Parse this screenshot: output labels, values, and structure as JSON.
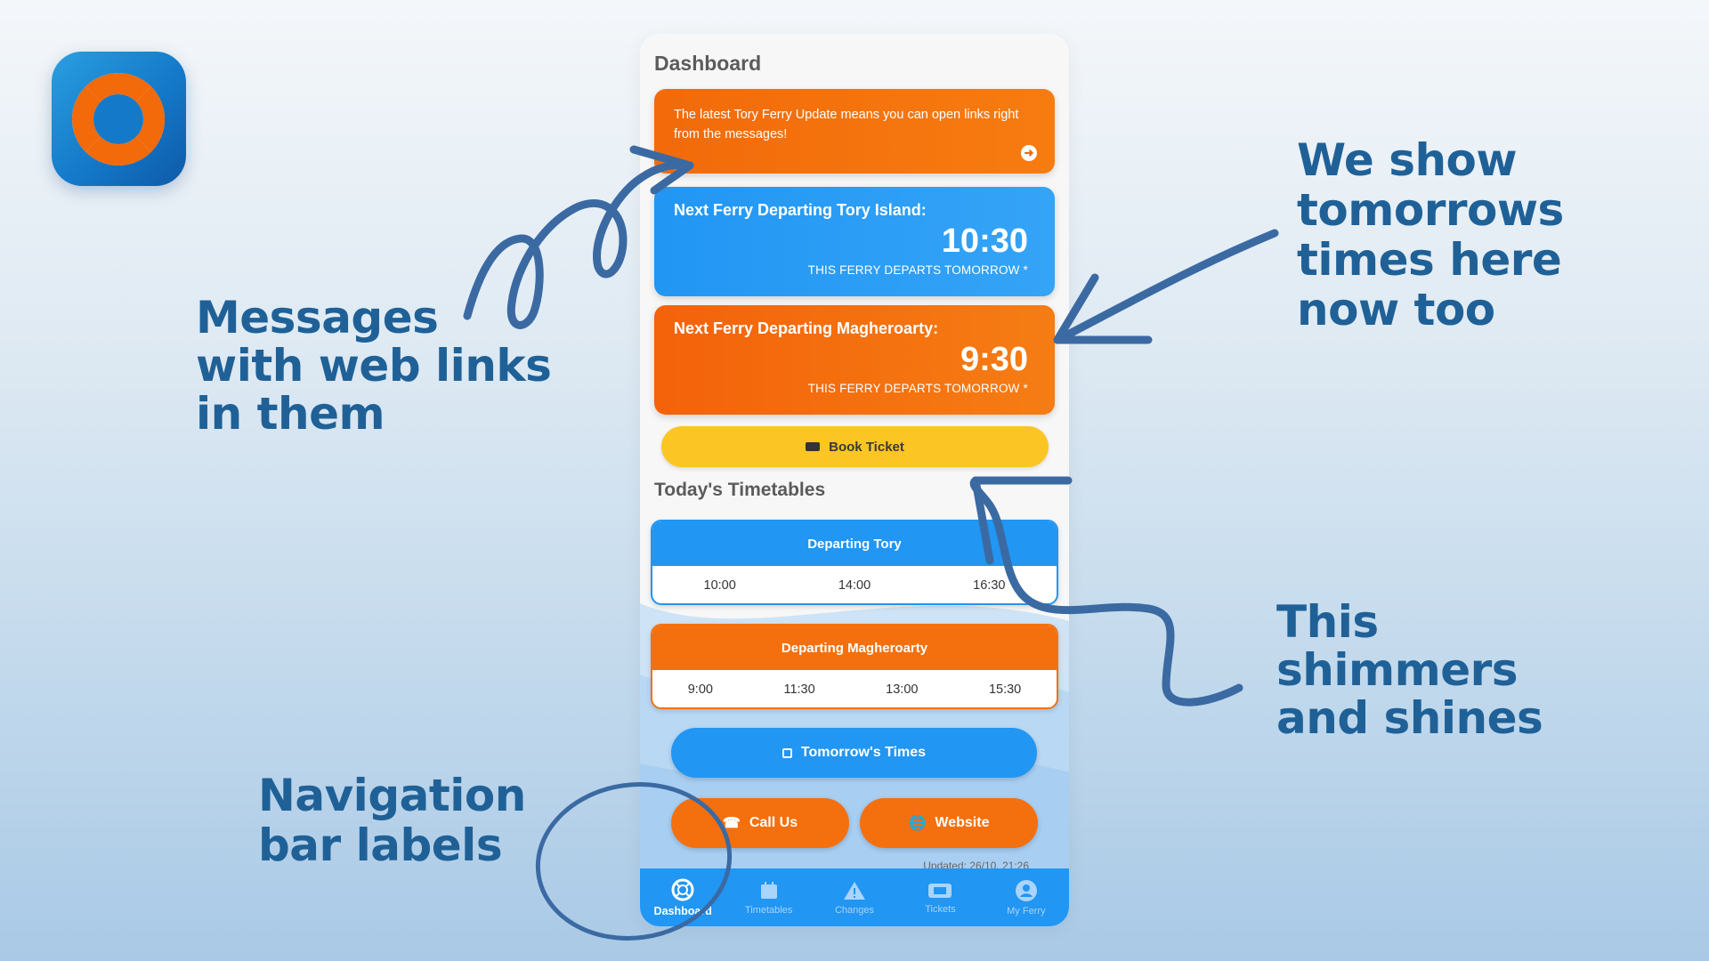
{
  "app": {
    "icon": "lifebuoy-icon",
    "dashboard_title": "Dashboard",
    "message": {
      "text": "The latest Tory Ferry Update means you can open links right from the messages!",
      "arrow_icon": "arrow-right-circle-icon"
    },
    "next_tory": {
      "label": "Next Ferry Departing Tory Island:",
      "time": "10:30",
      "note": "THIS FERRY DEPARTS TOMORROW *"
    },
    "next_magheroarty": {
      "label": "Next Ferry Departing Magheroarty:",
      "time": "9:30",
      "note": "THIS FERRY DEPARTS TOMORROW *"
    },
    "book_ticket": "Book Ticket",
    "todays_timetables": "Today's Timetables",
    "timetables": [
      {
        "title": "Departing Tory",
        "times": [
          "10:00",
          "14:00",
          "16:30"
        ]
      },
      {
        "title": "Departing Magheroarty",
        "times": [
          "9:00",
          "11:30",
          "13:00",
          "15:30"
        ]
      }
    ],
    "tomorrows_times": "Tomorrow's Times",
    "call_us": "Call Us",
    "website": "Website",
    "updated": "Updated: 26/10, 21:26",
    "nav": [
      {
        "label": "Dashboard",
        "icon": "lifebuoy-icon",
        "active": true
      },
      {
        "label": "Timetables",
        "icon": "calendar-icon",
        "active": false
      },
      {
        "label": "Changes",
        "icon": "warning-icon",
        "active": false
      },
      {
        "label": "Tickets",
        "icon": "ticket-icon",
        "active": false
      },
      {
        "label": "My Ferry",
        "icon": "account-icon",
        "active": false
      }
    ]
  },
  "callouts": {
    "messages": [
      "Messages",
      "with web links",
      "in them"
    ],
    "tomorrow": [
      "We show",
      "tomorrows",
      "times here",
      "now too"
    ],
    "shimmer": [
      "This",
      "shimmers",
      "and shines"
    ],
    "nav": [
      "Navigation",
      "bar labels"
    ]
  },
  "colors": {
    "orange": "#f4700e",
    "blue": "#2196f3",
    "yellow": "#fbc524",
    "callout_text": "#1f6197"
  }
}
